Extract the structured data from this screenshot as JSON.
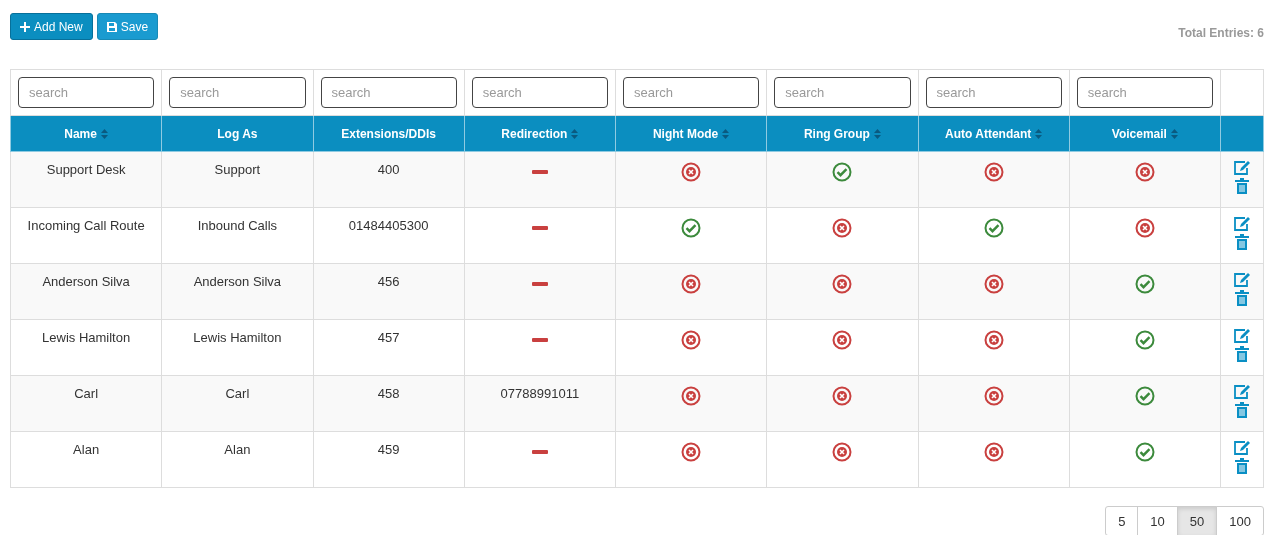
{
  "toolbar": {
    "buttons": [
      {
        "label": "Add New",
        "kind": "add"
      },
      {
        "label": "Save",
        "kind": "save"
      }
    ],
    "total": "Total Entries: 6"
  },
  "table": {
    "columns": [
      {
        "label": "Name",
        "sortable": true,
        "placeholder": "search"
      },
      {
        "label": "Log As",
        "sortable": false,
        "placeholder": "search"
      },
      {
        "label": "Extensions/DDIs",
        "sortable": false,
        "placeholder": "search"
      },
      {
        "label": "Redirection",
        "sortable": true,
        "placeholder": "search"
      },
      {
        "label": "Night Mode",
        "sortable": true,
        "placeholder": "search"
      },
      {
        "label": "Ring Group",
        "sortable": true,
        "placeholder": "search"
      },
      {
        "label": "Auto Attendant",
        "sortable": true,
        "placeholder": "search"
      },
      {
        "label": "Voicemail",
        "sortable": true,
        "placeholder": "search"
      }
    ],
    "rows": [
      {
        "name": "Support Desk",
        "log_as": "Support",
        "extension": "400",
        "redirection": {
          "kind": "none"
        },
        "night_mode": false,
        "ring_group": true,
        "auto_attendant": false,
        "voicemail": false
      },
      {
        "name": "Incoming Call Route",
        "log_as": "Inbound Calls",
        "extension": "01484405300",
        "redirection": {
          "kind": "none"
        },
        "night_mode": true,
        "ring_group": false,
        "auto_attendant": true,
        "voicemail": false
      },
      {
        "name": "Anderson Silva",
        "log_as": "Anderson Silva",
        "extension": "456",
        "redirection": {
          "kind": "none"
        },
        "night_mode": false,
        "ring_group": false,
        "auto_attendant": false,
        "voicemail": true
      },
      {
        "name": "Lewis Hamilton",
        "log_as": "Lewis Hamilton",
        "extension": "457",
        "redirection": {
          "kind": "none"
        },
        "night_mode": false,
        "ring_group": false,
        "auto_attendant": false,
        "voicemail": true
      },
      {
        "name": "Carl",
        "log_as": "Carl",
        "extension": "458",
        "redirection": {
          "kind": "text",
          "text": "07788991011"
        },
        "night_mode": false,
        "ring_group": false,
        "auto_attendant": false,
        "voicemail": true
      },
      {
        "name": "Alan",
        "log_as": "Alan",
        "extension": "459",
        "redirection": {
          "kind": "none"
        },
        "night_mode": false,
        "ring_group": false,
        "auto_attendant": false,
        "voicemail": true
      }
    ]
  },
  "page_sizes": [
    {
      "label": "5",
      "selected": false
    },
    {
      "label": "10",
      "selected": false
    },
    {
      "label": "50",
      "selected": true
    },
    {
      "label": "100",
      "selected": false
    }
  ]
}
